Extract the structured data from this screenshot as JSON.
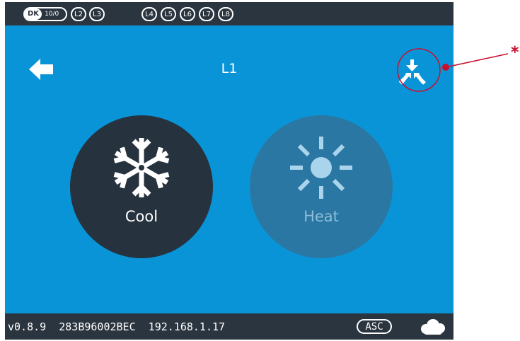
{
  "statusbar": {
    "dk_label": "DK",
    "dk_count": "10/0",
    "levels": [
      "L2",
      "L3",
      "L4",
      "L5",
      "L6",
      "L7",
      "L8"
    ]
  },
  "header": {
    "title": "L1",
    "back_icon": "arrow-left-icon",
    "collapse_icon": "collapse-arrows-icon"
  },
  "modes": {
    "cool": {
      "label": "Cool",
      "icon": "snowflake-icon",
      "selected": true
    },
    "heat": {
      "label": "Heat",
      "icon": "sun-icon",
      "selected": false
    }
  },
  "footer": {
    "info": "v0.8.9  283B96002BEC  192.168.1.17",
    "badge": "ASC",
    "cloud_icon": "cloud-icon"
  },
  "annotation": {
    "marker": "*"
  },
  "colors": {
    "screen_bg": "#0a94d8",
    "bar_bg": "#2b3540",
    "cool_bg": "#26323d",
    "heat_bg": "#2a77a3",
    "annotation": "#c8102e"
  }
}
